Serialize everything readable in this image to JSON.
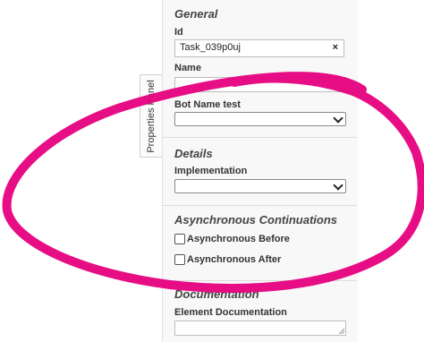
{
  "tab": {
    "label": "Properties Panel"
  },
  "general": {
    "title": "General",
    "id_label": "Id",
    "id_value": "Task_039p0uj",
    "clear_icon": "×",
    "name_label": "Name",
    "bot_name_label": "Bot Name test"
  },
  "details": {
    "title": "Details",
    "implementation_label": "Implementation"
  },
  "async": {
    "title": "Asynchronous Continuations",
    "before_label": "Asynchronous Before",
    "after_label": "Asynchronous After"
  },
  "documentation": {
    "title": "Documentation",
    "element_doc_label": "Element Documentation"
  },
  "colors": {
    "annotation": "#e6007e",
    "panel_bg": "#f8f8f8"
  },
  "icons": {
    "clear": "close-icon",
    "select": "chevron-down-icon",
    "resize": "resize-grip-icon"
  }
}
